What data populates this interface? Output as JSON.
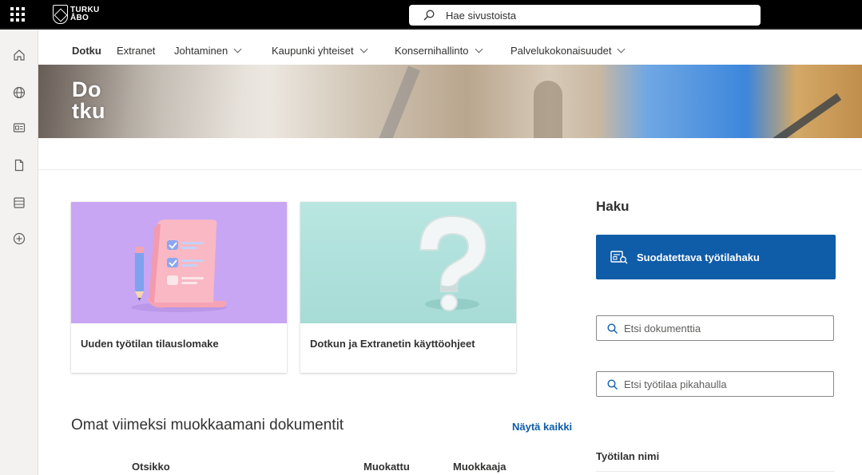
{
  "suitebar": {
    "logo_line1": "TURKU",
    "logo_line2": "ÅBO",
    "search_placeholder": "Hae sivustoista"
  },
  "appbar": {
    "items": [
      "home-icon",
      "globe-icon",
      "news-icon",
      "document-icon",
      "list-icon",
      "add-icon"
    ]
  },
  "topnav": {
    "items": [
      {
        "label": "Dotku",
        "active": true,
        "dropdown": false
      },
      {
        "label": "Extranet",
        "active": false,
        "dropdown": false
      },
      {
        "label": "Johtaminen",
        "active": false,
        "dropdown": true
      },
      {
        "label": "Kaupunki yhteiset",
        "active": false,
        "dropdown": true
      },
      {
        "label": "Konsernihallinto",
        "active": false,
        "dropdown": true
      },
      {
        "label": "Palvelukokonaisuudet",
        "active": false,
        "dropdown": true
      }
    ]
  },
  "hero": {
    "title_line1": "Do",
    "title_line2": "tku"
  },
  "cards": [
    {
      "title": "Uuden työtilan tilauslomake",
      "image": "order-form-illustration"
    },
    {
      "title": "Dotkun ja Extranetin käyttöohjeet",
      "image": "question-mark-illustration"
    }
  ],
  "haku": {
    "title": "Haku",
    "button_label": "Suodatettava työtilahaku",
    "search_document_placeholder": "Etsi dokumenttia",
    "search_workspace_placeholder": "Etsi työtilaa pikahaulla",
    "workspace_column": "Työtilan nimi"
  },
  "documents": {
    "title": "Omat viimeksi muokkaamani dokumentit",
    "show_all": "Näytä kaikki",
    "columns": [
      "Otsikko",
      "Muokattu",
      "Muokkaaja"
    ]
  },
  "colors": {
    "primary": "#0f5ca9",
    "suitebar": "#000000",
    "card1_bg": "#c8a6f4",
    "card2_bg": "#b9e6e1"
  }
}
